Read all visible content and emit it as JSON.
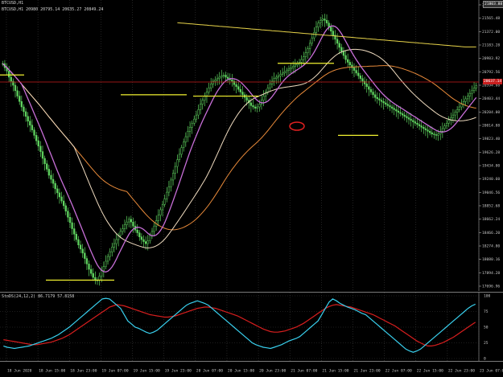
{
  "symbol_header": "BTCUSD,H1",
  "ohlc_header": "BTCUSD,H1  20980 20795.14 20635.27 20849.24",
  "osc_header": "StoDS(24,12,2) 86.7179 57.8158",
  "current_price": "20637.14",
  "top_right_price": "21803.88",
  "colors": {
    "candle": "#5fd35f",
    "ma_fast": "#c86fd8",
    "ma_mid": "#f0dcc0",
    "ma_slow": "#e88a3a",
    "ma_long": "#e8d44a",
    "hline": "#f2f230",
    "price_line": "#c81e1e",
    "stoch_main": "#39d0ee",
    "stoch_signal": "#d81e1e",
    "ellipse": "#e02020"
  },
  "price_ticks": [
    "21803.88",
    "21565.48",
    "21372.00",
    "21183.28",
    "20983.92",
    "20792.56",
    "20594.88",
    "20403.44",
    "20204.00",
    "20014.88",
    "19823.40",
    "19626.28",
    "19434.00",
    "19240.60",
    "19046.56",
    "18852.68",
    "18662.24",
    "18466.20",
    "18274.80",
    "18080.16",
    "17894.28",
    "17696.96"
  ],
  "osc_ticks": [
    "100",
    "75",
    "50",
    "25",
    "0"
  ],
  "time_ticks": [
    "18 Jun 2020",
    "18 Jun 15:00",
    "18 Jun 23:00",
    "19 Jun 07:00",
    "19 Jun 15:00",
    "19 Jun 23:00",
    "20 Jun 07:00",
    "20 Jun 15:00",
    "20 Jun 23:00",
    "21 Jun 07:00",
    "21 Jun 15:00",
    "21 Jun 23:00",
    "22 Jun 07:00",
    "22 Jun 15:00",
    "22 Jun 23:00",
    "23 Jun 07:00"
  ],
  "chart_data": {
    "type": "line",
    "symbol": "BTCUSD",
    "timeframe": "H1",
    "price_range": [
      17600,
      21900
    ],
    "candles_close": [
      20960,
      20900,
      20850,
      20760,
      20700,
      20640,
      20560,
      20480,
      20400,
      20320,
      20250,
      20180,
      20110,
      20050,
      19980,
      19900,
      19820,
      19740,
      19660,
      19560,
      19480,
      19400,
      19310,
      19250,
      19190,
      19110,
      19050,
      18990,
      18930,
      18860,
      18780,
      18690,
      18610,
      18520,
      18440,
      18360,
      18280,
      18220,
      18160,
      18080,
      18000,
      17920,
      17860,
      17800,
      17760,
      17760,
      17820,
      17900,
      17960,
      18040,
      18110,
      18180,
      18250,
      18300,
      18360,
      18420,
      18480,
      18520,
      18580,
      18620,
      18660,
      18620,
      18560,
      18500,
      18460,
      18400,
      18360,
      18330,
      18300,
      18340,
      18420,
      18480,
      18560,
      18640,
      18720,
      18800,
      18880,
      18960,
      19060,
      19140,
      19240,
      19340,
      19440,
      19540,
      19620,
      19720,
      19800,
      19880,
      19960,
      20020,
      20080,
      20140,
      20200,
      20280,
      20360,
      20420,
      20480,
      20540,
      20600,
      20660,
      20700,
      20720,
      20740,
      20760,
      20780,
      20790,
      20760,
      20740,
      20720,
      20700,
      20650,
      20620,
      20580,
      20540,
      20500,
      20460,
      20420,
      20380,
      20340,
      20320,
      20300,
      20320,
      20360,
      20420,
      20480,
      20540,
      20600,
      20660,
      20700,
      20740,
      20760,
      20780,
      20800,
      20820,
      20840,
      20860,
      20880,
      20900,
      20920,
      20940,
      20960,
      20980,
      21020,
      21060,
      21120,
      21180,
      21260,
      21340,
      21420,
      21500,
      21560,
      21600,
      21620,
      21600,
      21560,
      21500,
      21440,
      21380,
      21320,
      21260,
      21200,
      21140,
      21080,
      21020,
      20980,
      20940,
      20900,
      20860,
      20820,
      20780,
      20740,
      20700,
      20660,
      20620,
      20580,
      20540,
      20500,
      20460,
      20440,
      20420,
      20400,
      20380,
      20360,
      20340,
      20320,
      20300,
      20280,
      20260,
      20240,
      20220,
      20200,
      20180,
      20160,
      20140,
      20120,
      20100,
      20080,
      20060,
      20040,
      20020,
      20000,
      19980,
      19960,
      19940,
      19920,
      19910,
      19900,
      19920,
      19960,
      20000,
      20040,
      20080,
      20120,
      20160,
      20200,
      20240,
      20280,
      20320,
      20360,
      20400,
      20440,
      20480,
      20520,
      20560,
      20600,
      20637
    ],
    "horizontal_levels": [
      20792,
      17760,
      20500,
      20480,
      19900
    ],
    "stoch_main": [
      20,
      18,
      17,
      16,
      17,
      18,
      19,
      20,
      22,
      24,
      26,
      28,
      30,
      32,
      35,
      38,
      42,
      46,
      50,
      55,
      60,
      65,
      70,
      75,
      80,
      85,
      90,
      95,
      96,
      95,
      90,
      85,
      80,
      70,
      60,
      55,
      50,
      48,
      45,
      42,
      40,
      42,
      45,
      50,
      55,
      60,
      65,
      70,
      75,
      80,
      85,
      88,
      90,
      92,
      90,
      88,
      85,
      80,
      75,
      70,
      65,
      60,
      55,
      50,
      45,
      40,
      35,
      30,
      25,
      22,
      20,
      18,
      17,
      16,
      18,
      20,
      22,
      25,
      28,
      30,
      32,
      35,
      40,
      45,
      50,
      55,
      60,
      70,
      80,
      90,
      95,
      92,
      88,
      85,
      82,
      80,
      78,
      75,
      72,
      70,
      65,
      60,
      55,
      50,
      45,
      40,
      35,
      30,
      25,
      20,
      15,
      12,
      10,
      12,
      15,
      20,
      25,
      30,
      35,
      40,
      45,
      50,
      55,
      60,
      65,
      70,
      75,
      80,
      84,
      86.7
    ],
    "stoch_signal": [
      30,
      29,
      28,
      27,
      26,
      25,
      24,
      23,
      22,
      22,
      23,
      24,
      25,
      26,
      28,
      30,
      32,
      35,
      38,
      42,
      46,
      50,
      54,
      58,
      62,
      66,
      70,
      74,
      78,
      82,
      84,
      86,
      85,
      84,
      82,
      80,
      78,
      76,
      74,
      72,
      70,
      69,
      68,
      67,
      66,
      66,
      67,
      68,
      70,
      72,
      74,
      76,
      78,
      80,
      81,
      82,
      82,
      81,
      80,
      78,
      76,
      74,
      72,
      70,
      68,
      65,
      62,
      59,
      56,
      53,
      50,
      47,
      45,
      43,
      42,
      42,
      43,
      44,
      46,
      48,
      50,
      53,
      56,
      60,
      64,
      68,
      72,
      76,
      80,
      83,
      85,
      86,
      85,
      84,
      83,
      82,
      80,
      78,
      76,
      74,
      72,
      70,
      67,
      64,
      61,
      58,
      55,
      52,
      48,
      44,
      40,
      36,
      32,
      28,
      25,
      22,
      20,
      20,
      21,
      23,
      25,
      28,
      31,
      34,
      38,
      42,
      46,
      50,
      54,
      57.8
    ]
  }
}
